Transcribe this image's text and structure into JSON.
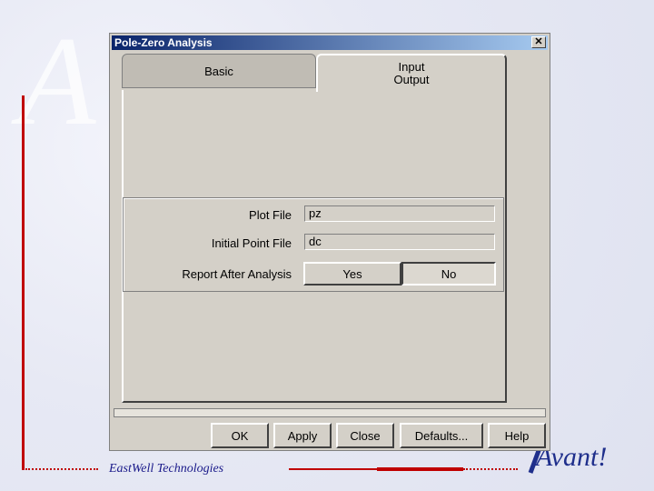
{
  "window": {
    "title": "Pole-Zero Analysis",
    "close_symbol": "✕"
  },
  "tabs": [
    {
      "label": "Basic",
      "active": false
    },
    {
      "label_line1": "Input",
      "label_line2": "Output",
      "active": true
    }
  ],
  "fields": {
    "plot_file": {
      "label": "Plot File",
      "value": "pz"
    },
    "initial_point_file": {
      "label": "Initial Point File",
      "value": "dc"
    }
  },
  "report": {
    "label": "Report After Analysis",
    "yes": "Yes",
    "no": "No",
    "selected": "No"
  },
  "buttons": {
    "ok": "OK",
    "apply": "Apply",
    "close": "Close",
    "defaults": "Defaults...",
    "help": "Help"
  },
  "footer": {
    "company": "EastWell Technologies",
    "logo_text": "Avant!"
  }
}
